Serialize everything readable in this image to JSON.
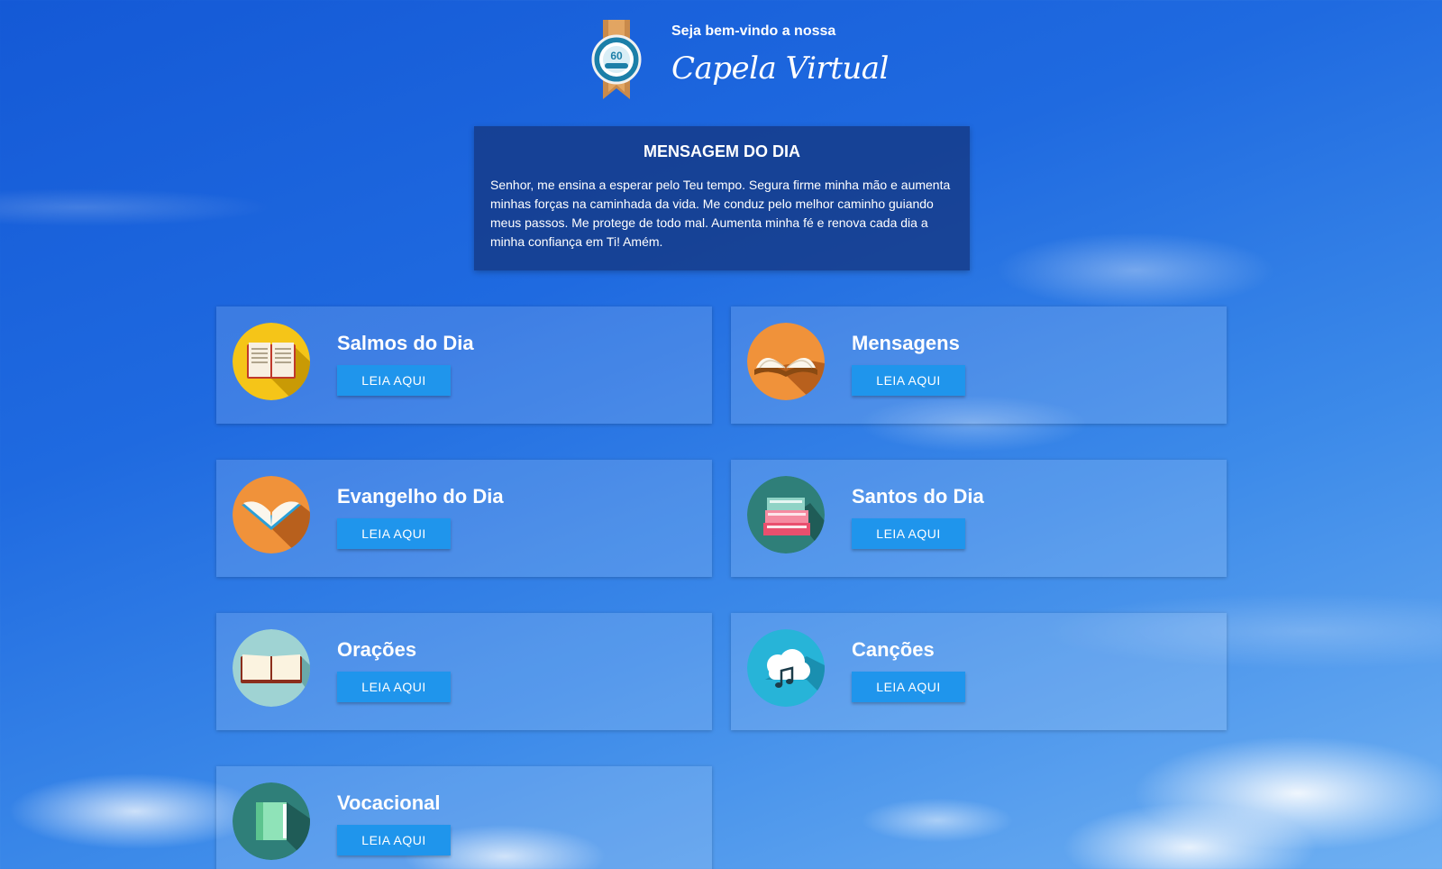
{
  "header": {
    "welcome": "Seja bem-vindo a nossa",
    "brand": "Capela Virtual",
    "logo_badge_text": "60"
  },
  "message_of_day": {
    "title": "MENSAGEM DO DIA",
    "text": "Senhor, me ensina a esperar pelo Teu tempo. Segura firme minha mão e aumenta minhas forças na caminhada da vida. Me conduz pelo melhor caminho guiando meus passos. Me protege de todo mal. Aumenta minha fé e renova cada dia a minha confiança em Ti! Amém."
  },
  "cards": [
    {
      "title": "Salmos do Dia",
      "button": "LEIA AQUI",
      "icon": "open-book-icon",
      "icon_bg": "#f5c518"
    },
    {
      "title": "Mensagens",
      "button": "LEIA AQUI",
      "icon": "open-book-pages-icon",
      "icon_bg": "#f0923a"
    },
    {
      "title": "Evangelho do Dia",
      "button": "LEIA AQUI",
      "icon": "open-book-icon",
      "icon_bg": "#f0923a"
    },
    {
      "title": "Santos do Dia",
      "button": "LEIA AQUI",
      "icon": "book-stack-icon",
      "icon_bg": "#2f7f79"
    },
    {
      "title": "Orações",
      "button": "LEIA AQUI",
      "icon": "open-book-icon",
      "icon_bg": "#9fd3d3"
    },
    {
      "title": "Canções",
      "button": "LEIA AQUI",
      "icon": "music-cloud-icon",
      "icon_bg": "#27b4d8"
    },
    {
      "title": "Vocacional",
      "button": "LEIA AQUI",
      "icon": "closed-book-icon",
      "icon_bg": "#2f7f79"
    }
  ],
  "colors": {
    "button": "#1f95ec",
    "motd_bg": "#143782"
  }
}
